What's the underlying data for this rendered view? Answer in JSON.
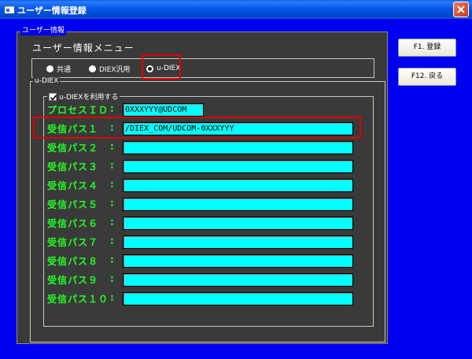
{
  "window": {
    "title": "ユーザー情報登録",
    "icons": {
      "app": "app-window-icon",
      "close": "close-icon"
    }
  },
  "panel": {
    "legend": "ユーザー情報",
    "menu_title": "ユーザー情報メニュー"
  },
  "radio_group": {
    "options": [
      {
        "label": "共通",
        "checked": false
      },
      {
        "label": "DIEX汎用",
        "checked": false
      },
      {
        "label": "u-DIEX",
        "checked": true
      }
    ]
  },
  "udiex": {
    "legend": "u-DIEX",
    "use_checkbox_label": "u-DIEXを利用する",
    "use_checkbox_checked": true,
    "colon": ":",
    "process_id": {
      "label": "プロセスＩＤ",
      "value": "0XXXYYY@UDCOM"
    },
    "paths": [
      {
        "label": "受信パス１",
        "value": "/DIEX_COM/UDCOM-0XXXYYY"
      },
      {
        "label": "受信パス２",
        "value": ""
      },
      {
        "label": "受信パス３",
        "value": ""
      },
      {
        "label": "受信パス４",
        "value": ""
      },
      {
        "label": "受信パス５",
        "value": ""
      },
      {
        "label": "受信パス６",
        "value": ""
      },
      {
        "label": "受信パス７",
        "value": ""
      },
      {
        "label": "受信パス８",
        "value": ""
      },
      {
        "label": "受信パス９",
        "value": ""
      },
      {
        "label": "受信パス１０",
        "value": ""
      }
    ]
  },
  "buttons": {
    "register": "F1. 登録",
    "back": "F12. 戻る"
  },
  "colors": {
    "background": "#0000f0",
    "panel": "#3a3a3a",
    "label_green": "#22ff22",
    "input_cyan": "#00ffff",
    "highlight_red": "#e00000"
  }
}
